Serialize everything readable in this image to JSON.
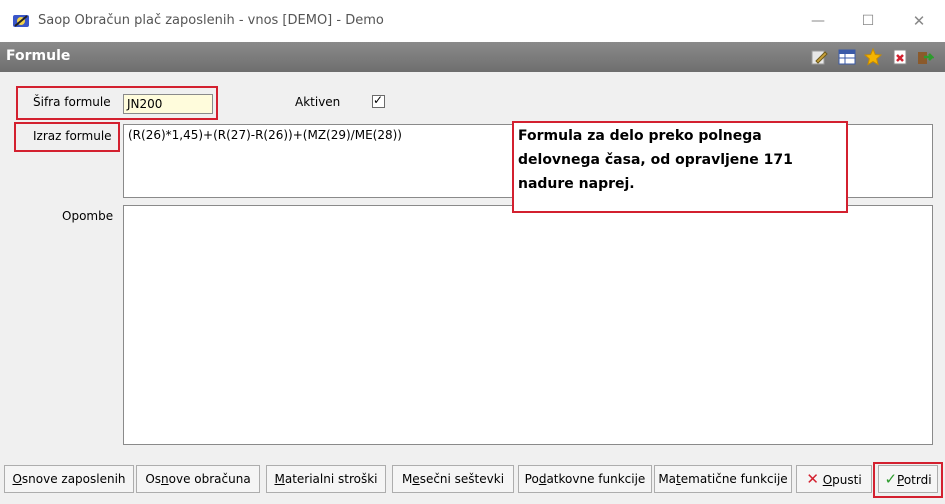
{
  "window": {
    "title": "Saop Obračun plač zaposlenih - vnos [DEMO] - Demo",
    "minimize_glyph": "—",
    "maximize_glyph": "☐",
    "close_glyph": "✕"
  },
  "header": {
    "title": "Formule",
    "toolbar_icons": [
      "edit-icon",
      "table-icon",
      "star-icon",
      "close-doc-icon",
      "exit-icon"
    ]
  },
  "form": {
    "sifra_label": "Šifra formule",
    "sifra_value": "JN200",
    "aktiven_label": "Aktiven",
    "aktiven_checked_glyph": "✓",
    "izraz_label": "Izraz formule",
    "izraz_value": "(R(26)*1,45)+(R(27)-R(26))+(MZ(29)/ME(28))",
    "opombe_label": "Opombe",
    "opombe_value": ""
  },
  "annotation": {
    "line1": "Formula za delo preko polnega",
    "line2": "delovnega časa, od opravljene 171",
    "line3": "nadure naprej."
  },
  "buttons": {
    "osnove_zaposlenih_u": "O",
    "osnove_zaposlenih_rest": "snove zaposlenih",
    "osnove_obracuna_pre": "Os",
    "osnove_obracuna_u": "n",
    "osnove_obracuna_rest": "ove obračuna",
    "materialni_u": "M",
    "materialni_rest": "aterialni stroški",
    "mesecni_pre": "M",
    "mesecni_u": "e",
    "mesecni_rest": "sečni seštevki",
    "podatkovne_pre": "Po",
    "podatkovne_u": "d",
    "podatkovne_rest": "atkovne funkcije",
    "matematicne_pre": "Ma",
    "matematicne_u": "t",
    "matematicne_rest": "ematične funkcije",
    "opusti_u": "O",
    "opusti_rest": "pusti",
    "potrdi_u": "P",
    "potrdi_rest": "otrdi"
  }
}
